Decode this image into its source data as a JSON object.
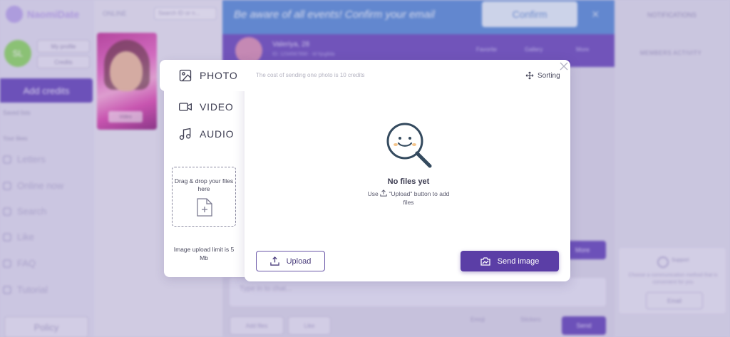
{
  "app": {
    "logo_text": "NaomiDate",
    "avatar_initials": "SL",
    "my_profile": "My profile",
    "credits": "Credits",
    "add_credits": "Add credits",
    "saved_label": "Saved lists",
    "your_likes": "Your likes",
    "nav": [
      "Letters",
      "Online now",
      "Search",
      "Like",
      "FAQ",
      "Tutorial"
    ],
    "policy": "Policy",
    "online_label": "ONLINE",
    "search_placeholder": "Search ID or n...",
    "profile_card_label": "Video"
  },
  "banner": {
    "text": "Be aware of all events!  Confirm your email",
    "confirm": "Confirm",
    "close": "×"
  },
  "chat": {
    "name": "Valeriya, 28",
    "sub": "ID: 1234567890 · Id hjsglida",
    "actions": [
      "Favorite",
      "Gallery",
      "More"
    ],
    "input_placeholder": "Type in to chat...",
    "more": "More",
    "bottom_actions": [
      "Add files",
      "Like",
      "Emoji",
      "Stickers"
    ],
    "send": "Send"
  },
  "right": {
    "notifications": "NOTIFICATIONS",
    "members_activity": "MEMBERS ACTIVITY",
    "support_title": "Support",
    "support_text": "Choose a communication method that is convenient for you",
    "support_email": "Email"
  },
  "modal": {
    "tabs": {
      "photo": "PHOTO",
      "video": "VIDEO",
      "audio": "AUDIO"
    },
    "dropzone_text": "Drag & drop your files here",
    "upload_limit": "Image upload limit is 5 Mb",
    "cost_note": "The cost of sending one photo is 10 credits",
    "sorting": "Sorting",
    "empty_title": "No files yet",
    "hint_use": "Use",
    "hint_rest": "\"Upload\" button to add files",
    "upload_label": "Upload",
    "send_label": "Send image"
  },
  "colors": {
    "accent": "#5b3ea6",
    "banner": "#5d8dd8"
  }
}
